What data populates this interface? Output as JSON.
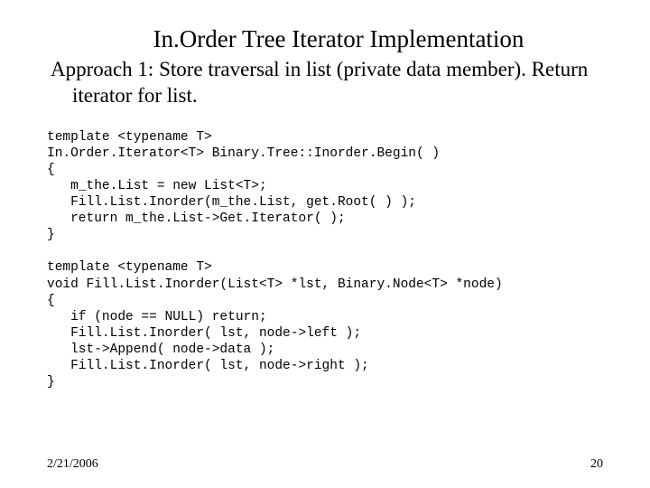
{
  "title": "In.Order Tree Iterator Implementation",
  "approach": "Approach 1: Store traversal in list (private data member). Return iterator for list.",
  "code1": "template <typename T>\nIn.Order.Iterator<T> Binary.Tree::Inorder.Begin( )\n{\n   m_the.List = new List<T>;\n   Fill.List.Inorder(m_the.List, get.Root( ) );\n   return m_the.List->Get.Iterator( );\n}",
  "code2": "template <typename T>\nvoid Fill.List.Inorder(List<T> *lst, Binary.Node<T> *node)\n{\n   if (node == NULL) return;\n   Fill.List.Inorder( lst, node->left );\n   lst->Append( node->data );\n   Fill.List.Inorder( lst, node->right );\n}",
  "footer_date": "2/21/2006",
  "footer_page": "20"
}
